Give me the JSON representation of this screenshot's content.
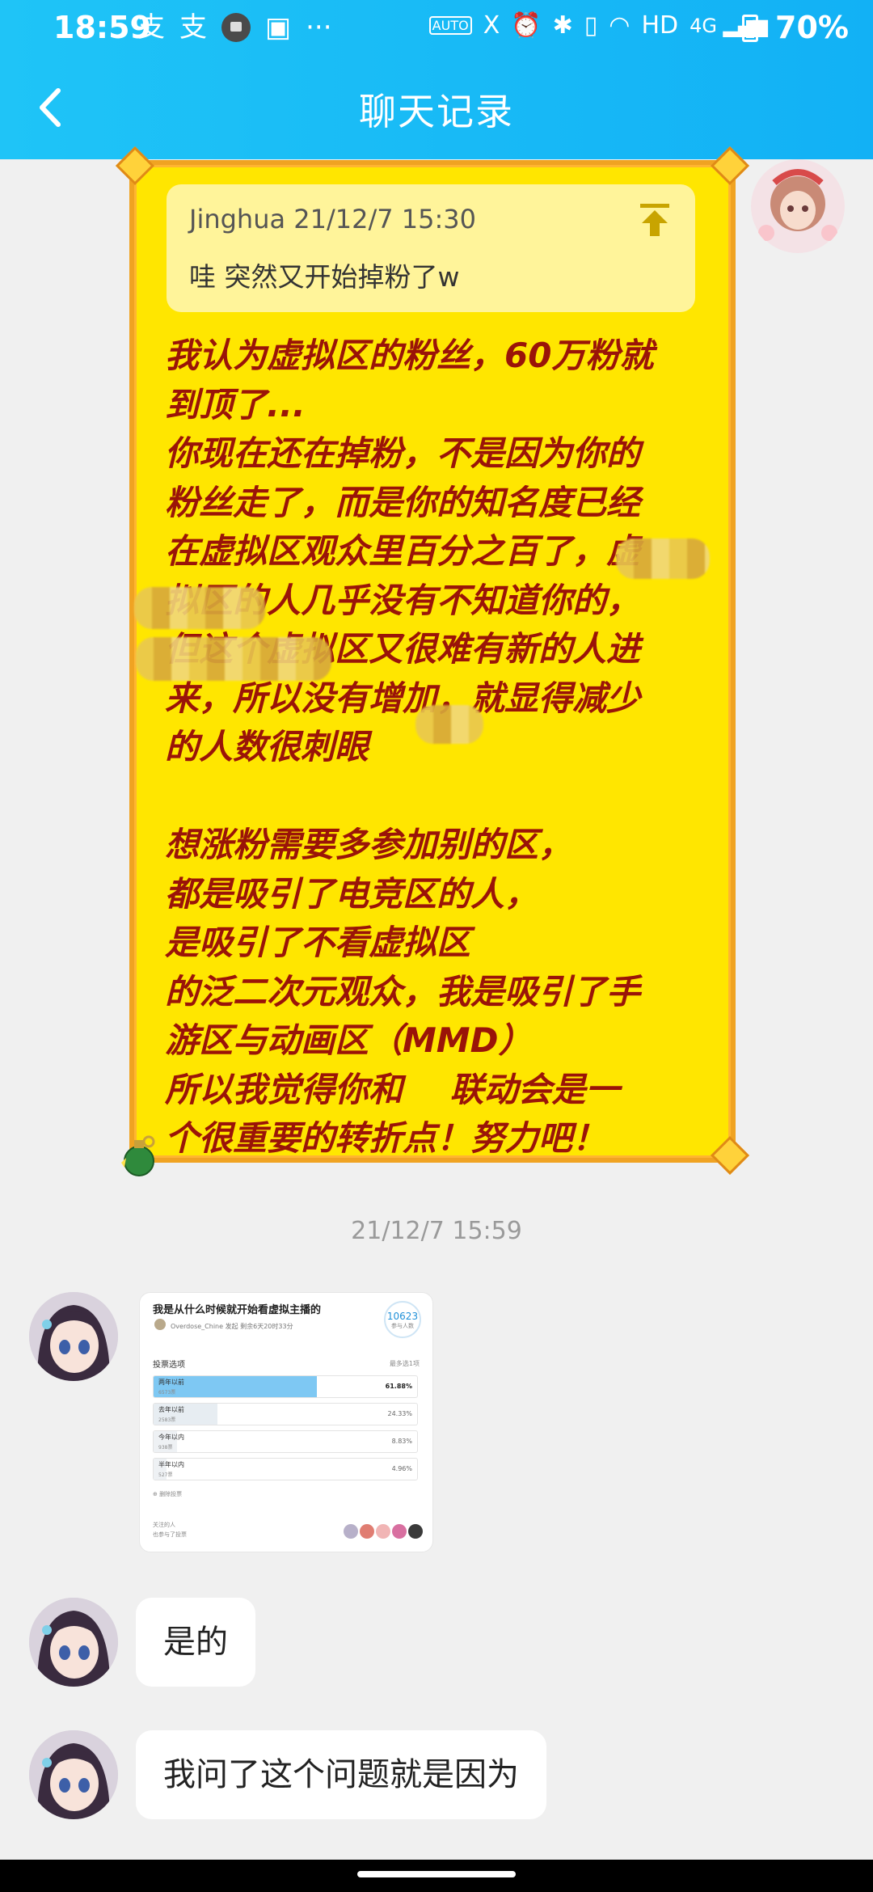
{
  "status_bar": {
    "time": "18:59",
    "left_icons": [
      "alipay-icon",
      "alipay-icon",
      "mail-icon",
      "image-icon",
      "more-dots-icon"
    ],
    "left_glyphs": [
      "支",
      "支",
      "",
      "▣",
      "···"
    ],
    "right_icons": [
      "auto-hz-icon",
      "x-icon",
      "alarm-icon",
      "bluetooth-icon",
      "vibrate-icon",
      "wifi-icon",
      "hd-icon",
      "4g-signal-icon",
      "battery-icon"
    ],
    "right_glyphs": [
      "AUTO",
      "X",
      "⏰",
      "✱",
      "▯",
      "◠",
      "HD",
      "4G ▂▄▆",
      ""
    ],
    "battery": "70%"
  },
  "header": {
    "title": "聊天记录",
    "background": "#14b6f6"
  },
  "card_message": {
    "quote": {
      "meta": "Jinghua 21/12/7 15:30",
      "text": "哇 突然又开始掉粉了w"
    },
    "body": "我认为虚拟区的粉丝，60万粉就\n到顶了...\n你现在还在掉粉，不是因为你的\n粉丝走了，而是你的知名度已经\n在虚拟区观众里百分之百了，虚\n拟区的人几乎没有不知道你的，\n但这个虚拟区又很难有新的人进\n来，所以没有增加，就显得减少\n的人数很刺眼\n\n想涨粉需要多参加别的区，\n都是吸引了电竞区的人，\n是吸引了不看虚拟区\n的泛二次元观众，我是吸引了手\n游区与动画区（MMD）\n所以我觉得你和    联动会是一\n个很重要的转折点！努力吧！",
    "text_color": "#9a1408",
    "card_color": "#ffe600"
  },
  "timestamp": "21/12/7 15:59",
  "image_message": {
    "title": "我是从什么时候就开始看虚拟主播的",
    "author": "Overdose_Chine  发起   剩余6天20时33分",
    "participants": "10623",
    "participants_label": "参与人数",
    "section_label": "投票选项",
    "section_right": "最多选1项",
    "options": [
      {
        "label": "两年以前",
        "sub": "6573票",
        "pct": "61.88%",
        "fraction": 0.6188,
        "color": "#7ec8f3"
      },
      {
        "label": "去年以前",
        "sub": "2583票",
        "pct": "24.33%",
        "fraction": 0.2433,
        "color": "#e7edf2"
      },
      {
        "label": "今年以内",
        "sub": "938票",
        "pct": "8.83%",
        "fraction": 0.0883,
        "color": "#eef1f4"
      },
      {
        "label": "半年以内",
        "sub": "527票",
        "pct": "4.96%",
        "fraction": 0.0496,
        "color": "#eef1f4"
      }
    ],
    "delete_label": "⊕ 删除投票",
    "footnote_1": "关注的人",
    "footnote_2": "也参与了投票"
  },
  "messages": [
    {
      "text": "是的"
    },
    {
      "text": "我问了这个问题就是因为"
    }
  ]
}
